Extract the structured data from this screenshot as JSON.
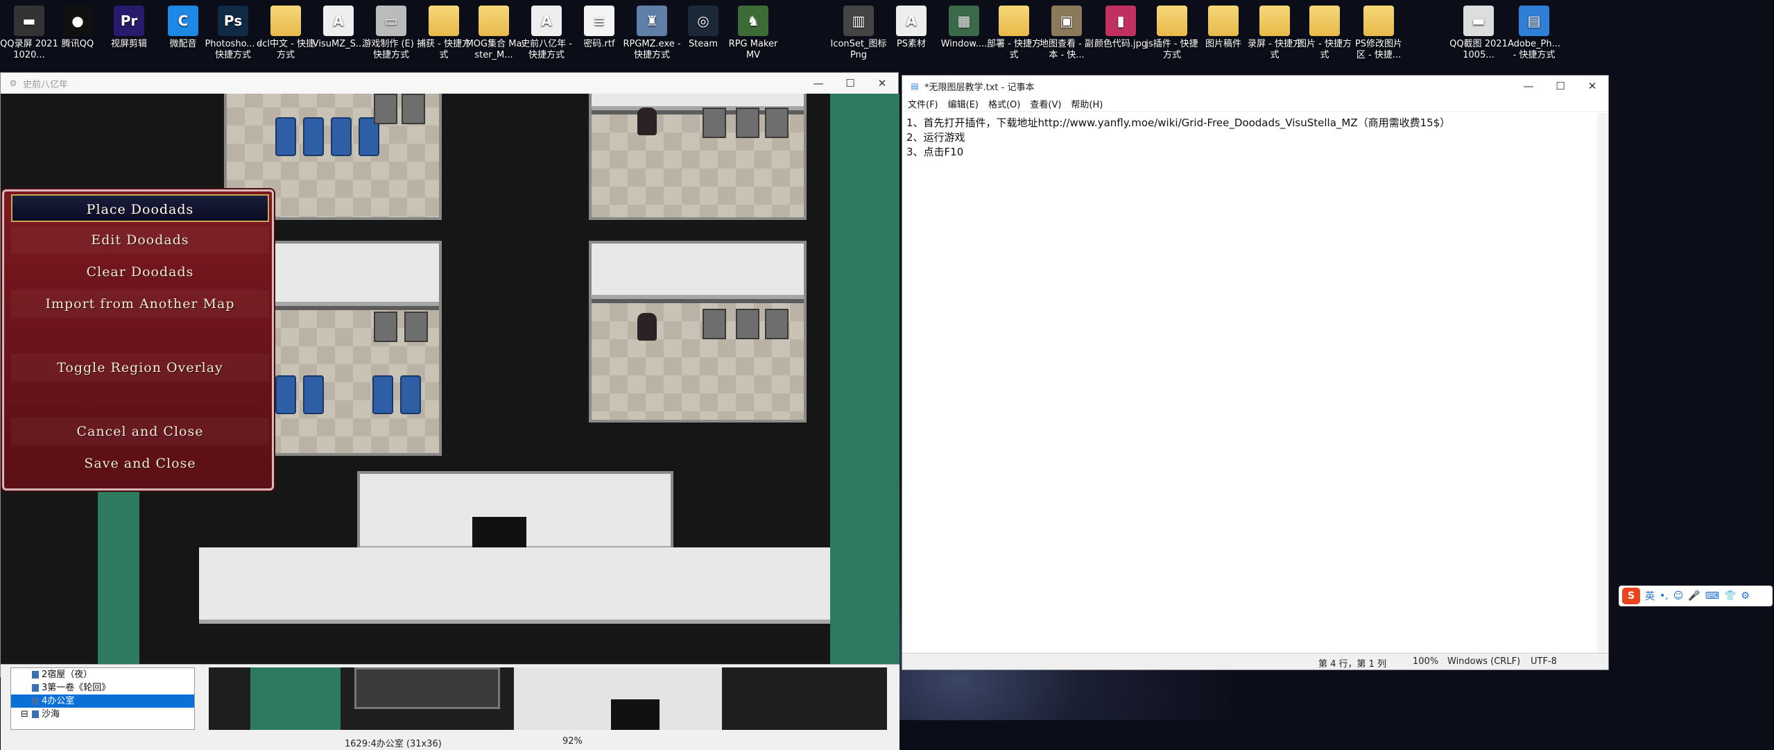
{
  "desktop_icons": [
    {
      "label": "QQ录屏 20211020...",
      "glyph": "▬",
      "color": "#333333"
    },
    {
      "label": "腾讯QQ",
      "glyph": "●",
      "color": "#111111"
    },
    {
      "label": "视屏剪辑",
      "glyph": "Pr",
      "color": "#2a1a6e"
    },
    {
      "label": "微配音",
      "glyph": "C",
      "color": "#1e88e5"
    },
    {
      "label": "Photosho... - 快捷方式",
      "glyph": "Ps",
      "color": "#0e2a45"
    },
    {
      "label": "dcl中文 - 快捷方式",
      "glyph": "",
      "color": "folder"
    },
    {
      "label": "VisuMZ_S...",
      "glyph": "A",
      "color": "#eeeeee"
    },
    {
      "label": "游戏制作 (E) - 快捷方式",
      "glyph": "▭",
      "color": "#bbbbbb"
    },
    {
      "label": "捕获 - 快捷方式",
      "glyph": "",
      "color": "folder"
    },
    {
      "label": "MOG集合 Master_M...",
      "glyph": "",
      "color": "folder"
    },
    {
      "label": "史前八亿年 - 快捷方式",
      "glyph": "A",
      "color": "#eeeeee"
    },
    {
      "label": "密码.rtf",
      "glyph": "≡",
      "color": "#f4f4f4"
    },
    {
      "label": "RPGMZ.exe - 快捷方式",
      "glyph": "♜",
      "color": "#5f7ea8"
    },
    {
      "label": "Steam",
      "glyph": "◎",
      "color": "#1b2838"
    },
    {
      "label": "RPG Maker MV",
      "glyph": "♞",
      "color": "#3d6b35"
    },
    {
      "label": "IconSet_图标 Png",
      "glyph": "▥",
      "color": "#444444"
    },
    {
      "label": "PS素材",
      "glyph": "A",
      "color": "#eeeeee"
    },
    {
      "label": "Window....",
      "glyph": "▦",
      "color": "#3a6a4a"
    },
    {
      "label": "部署 - 快捷方式",
      "glyph": "",
      "color": "folder"
    },
    {
      "label": "地图查看 - 副本 - 快...",
      "glyph": "▣",
      "color": "#8a7a5a"
    },
    {
      "label": "颜色代码.jpg",
      "glyph": "▮",
      "color": "#c03060"
    },
    {
      "label": "js插件 - 快捷方式",
      "glyph": "",
      "color": "folder"
    },
    {
      "label": "图片稿件",
      "glyph": "",
      "color": "folder"
    },
    {
      "label": "录屏 - 快捷方式",
      "glyph": "",
      "color": "folder"
    },
    {
      "label": "图片 - 快捷方式",
      "glyph": "",
      "color": "folder"
    },
    {
      "label": "PS修改图片 区 - 快捷...",
      "glyph": "",
      "color": "folder"
    },
    {
      "label": "QQ截图 20211005...",
      "glyph": "▬",
      "color": "#dddddd"
    },
    {
      "label": "Adobe_Ph... - 快捷方式",
      "glyph": "▤",
      "color": "#2f7fd6"
    }
  ],
  "game_window": {
    "title": "史前八亿年",
    "controls": {
      "minimize": "—",
      "maximize": "☐",
      "close": "✕"
    }
  },
  "doodad_menu": {
    "items": [
      {
        "label": "Place Doodads",
        "selected": true
      },
      {
        "label": "Edit Doodads"
      },
      {
        "label": "Clear Doodads"
      },
      {
        "label": "Import from Another Map"
      },
      {
        "label": ""
      },
      {
        "label": "Toggle Region Overlay"
      },
      {
        "label": ""
      },
      {
        "label": "Cancel and Close"
      },
      {
        "label": "Save and Close"
      }
    ]
  },
  "editor": {
    "map_tree": [
      {
        "label": "2宿屋（夜）",
        "selected": false,
        "toggle": ""
      },
      {
        "label": "3第一卷《轮回》",
        "selected": false,
        "toggle": ""
      },
      {
        "label": "4办公室",
        "selected": true,
        "toggle": ""
      },
      {
        "label": "沙海",
        "selected": false,
        "toggle": "⊟"
      }
    ],
    "status": {
      "map_info": "1629:4办公室 (31x36)",
      "zoom": "92%"
    }
  },
  "notepad": {
    "title": "*无限图层教学.txt - 记事本",
    "menu": [
      "文件(F)",
      "编辑(E)",
      "格式(O)",
      "查看(V)",
      "帮助(H)"
    ],
    "lines": [
      "1、首先打开插件，下载地址http://www.yanfly.moe/wiki/Grid-Free_Doodads_VisuStella_MZ（商用需收费15$）",
      "2、运行游戏",
      "3、点击F10"
    ],
    "status": {
      "position": "第 4 行，第 1 列",
      "zoom": "100%",
      "line_endings": "Windows (CRLF)",
      "encoding": "UTF-8"
    }
  },
  "ime_toolbar": {
    "logo": "S",
    "lang": "英",
    "icons": [
      "•,",
      "☺",
      "🎤",
      "⌨",
      "👕",
      "⚙"
    ]
  }
}
